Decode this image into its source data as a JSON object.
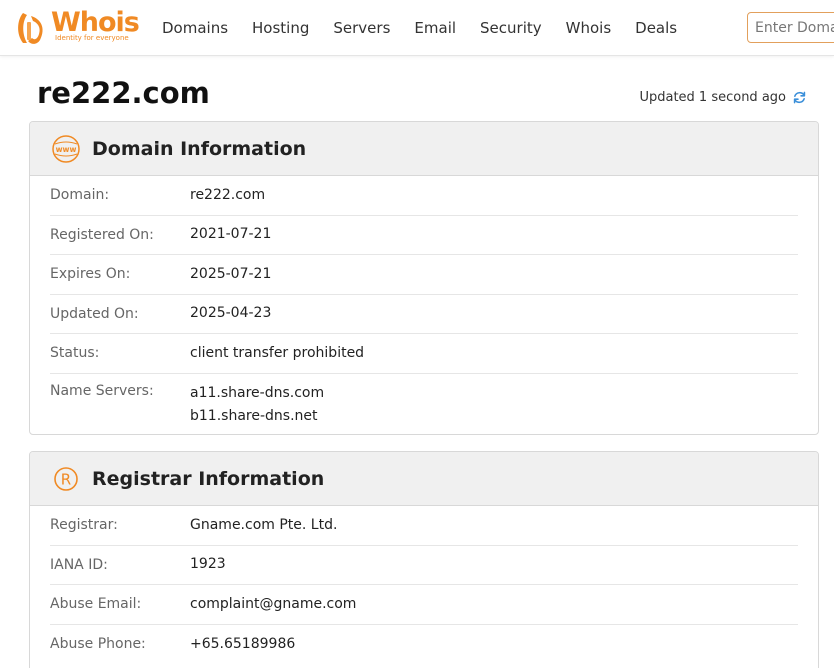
{
  "brand": {
    "name": "Whois",
    "tagline": "Identity for everyone",
    "color": "#f08a24"
  },
  "nav": {
    "items": [
      {
        "label": "Domains"
      },
      {
        "label": "Hosting"
      },
      {
        "label": "Servers"
      },
      {
        "label": "Email"
      },
      {
        "label": "Security"
      },
      {
        "label": "Whois"
      },
      {
        "label": "Deals"
      }
    ]
  },
  "search": {
    "placeholder": "Enter Domain or IP"
  },
  "page": {
    "domain": "re222.com",
    "updated_text": "Updated 1 second ago",
    "refresh_icon": "refresh-icon"
  },
  "domain_info": {
    "title": "Domain Information",
    "icon": "www-icon",
    "rows": [
      {
        "label": "Domain:",
        "value": "re222.com"
      },
      {
        "label": "Registered On:",
        "value": "2021-07-21"
      },
      {
        "label": "Expires On:",
        "value": "2025-07-21"
      },
      {
        "label": "Updated On:",
        "value": "2025-04-23"
      },
      {
        "label": "Status:",
        "value": "client transfer prohibited"
      },
      {
        "label": "Name Servers:",
        "values": [
          "a11.share-dns.com",
          "b11.share-dns.net"
        ]
      }
    ]
  },
  "registrar_info": {
    "title": "Registrar Information",
    "icon": "registered-icon",
    "rows": [
      {
        "label": "Registrar:",
        "value": "Gname.com Pte. Ltd."
      },
      {
        "label": "IANA ID:",
        "value": "1923"
      },
      {
        "label": "Abuse Email:",
        "value": "complaint@gname.com"
      },
      {
        "label": "Abuse Phone:",
        "value": "+65.65189986"
      }
    ]
  }
}
